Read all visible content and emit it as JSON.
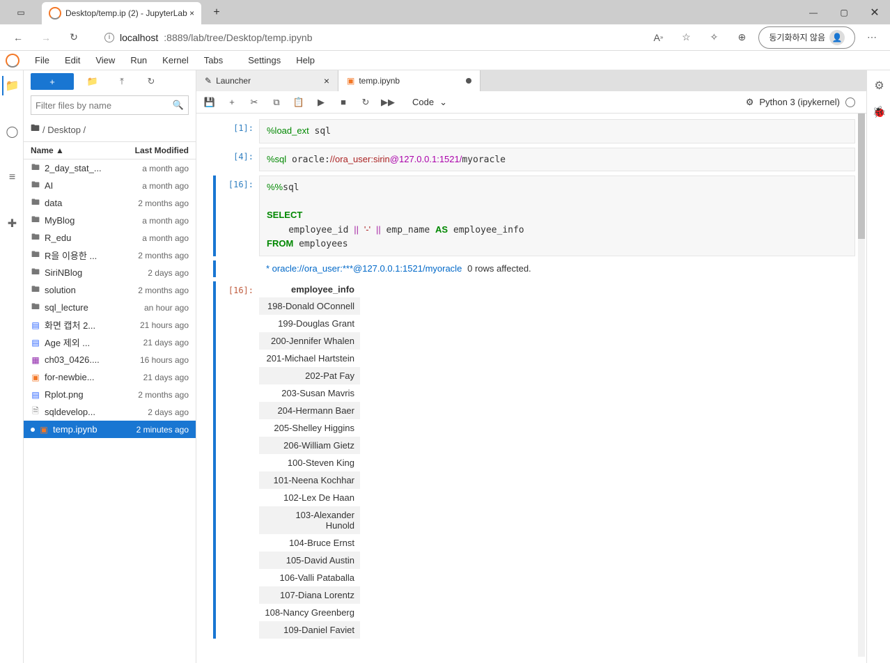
{
  "window": {
    "title": "Desktop/temp.ip (2) - JupyterLab ×"
  },
  "addressbar": {
    "prefix": "localhost",
    "rest": ":8889/lab/tree/Desktop/temp.ipynb",
    "sync": "동기화하지 않음"
  },
  "menus": [
    "File",
    "Edit",
    "View",
    "Run",
    "Kernel",
    "Tabs",
    "Settings",
    "Help"
  ],
  "filepanel": {
    "filter_placeholder": "Filter files by name",
    "path": "/ Desktop /",
    "columns": {
      "name": "Name",
      "modified": "Last Modified"
    },
    "files": [
      {
        "icon": "folder",
        "name": "2_day_stat_...",
        "mod": "a month ago"
      },
      {
        "icon": "folder",
        "name": "AI",
        "mod": "a month ago"
      },
      {
        "icon": "folder",
        "name": "data",
        "mod": "2 months ago"
      },
      {
        "icon": "folder",
        "name": "MyBlog",
        "mod": "a month ago"
      },
      {
        "icon": "folder",
        "name": "R_edu",
        "mod": "a month ago"
      },
      {
        "icon": "folder",
        "name": "R을 이용한 ...",
        "mod": "2 months ago"
      },
      {
        "icon": "folder",
        "name": "SiriNBlog",
        "mod": "2 days ago"
      },
      {
        "icon": "folder",
        "name": "solution",
        "mod": "2 months ago"
      },
      {
        "icon": "folder",
        "name": "sql_lecture",
        "mod": "an hour ago"
      },
      {
        "icon": "image",
        "name": "화면 캡처 2...",
        "mod": "21 hours ago"
      },
      {
        "icon": "image",
        "name": "Age 제외 ...",
        "mod": "21 days ago"
      },
      {
        "icon": "purple",
        "name": "ch03_0426....",
        "mod": "16 hours ago"
      },
      {
        "icon": "notebook",
        "name": "for-newbie...",
        "mod": "21 days ago"
      },
      {
        "icon": "image",
        "name": "Rplot.png",
        "mod": "2 months ago"
      },
      {
        "icon": "file",
        "name": "sqldevelop...",
        "mod": "2 days ago"
      },
      {
        "icon": "notebook",
        "name": "temp.ipynb",
        "mod": "2 minutes ago",
        "selected": true
      }
    ]
  },
  "tabs": [
    {
      "icon": "launcher",
      "label": "Launcher",
      "active": false,
      "closable": true
    },
    {
      "icon": "notebook",
      "label": "temp.ipynb",
      "active": true,
      "dirty": true
    }
  ],
  "toolbar": {
    "celltype": "Code"
  },
  "kernel": {
    "name": "Python 3 (ipykernel)"
  },
  "cells": {
    "c0": {
      "prompt": "[1]:"
    },
    "c1": {
      "prompt": "[4]:"
    },
    "c2": {
      "prompt": "[16]:"
    },
    "c2out_conn": " * oracle://ora_user:***@127.0.0.1:1521/myoracle",
    "c2out_rows": "0 rows affected.",
    "c2out_prompt": "[16]:",
    "c2out_head": "employee_info"
  },
  "results": [
    "198-Donald OConnell",
    "199-Douglas Grant",
    "200-Jennifer Whalen",
    "201-Michael Hartstein",
    "202-Pat Fay",
    "203-Susan Mavris",
    "204-Hermann Baer",
    "205-Shelley Higgins",
    "206-William Gietz",
    "100-Steven King",
    "101-Neena Kochhar",
    "102-Lex De Haan",
    "103-Alexander Hunold",
    "104-Bruce Ernst",
    "105-David Austin",
    "106-Valli Pataballa",
    "107-Diana Lorentz",
    "108-Nancy Greenberg",
    "109-Daniel Faviet"
  ]
}
